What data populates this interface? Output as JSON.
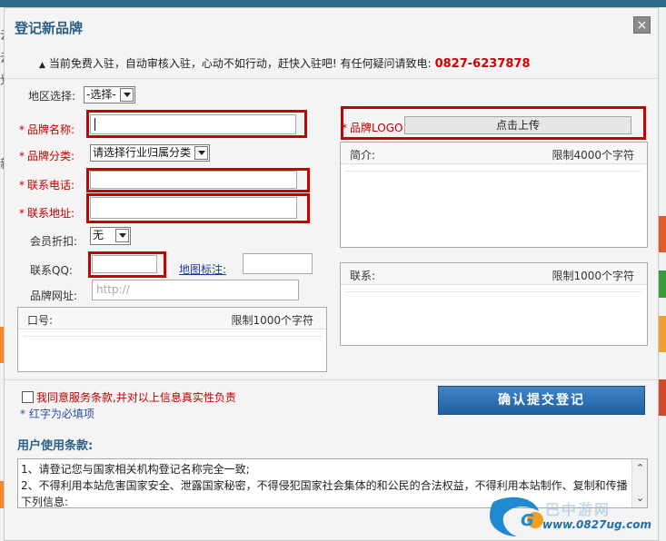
{
  "dialog": {
    "title": "登记新品牌",
    "close_label": "×",
    "notice_text": "当前免费入驻，自动审核入驻，心动不如行动，赶快入驻吧! 有任何疑问请致电:",
    "notice_phone": "0827-6237878"
  },
  "form": {
    "region_label": "地区选择:",
    "region_value": "-选择-",
    "brand_name_label": "品牌名称:",
    "brand_category_label": "品牌分类:",
    "brand_category_value": "请选择行业归属分类",
    "phone_label": "联系电话:",
    "address_label": "联系地址:",
    "discount_label": "会员折扣:",
    "discount_value": "无",
    "qq_label": "联系QQ:",
    "map_link": "地图标注:",
    "website_label": "品牌网址:",
    "website_placeholder": "http://",
    "slogan_label": "口号:",
    "slogan_limit": "限制1000个字符",
    "logo_label": "品牌LOGO",
    "upload_label": "点击上传",
    "intro_label": "简介:",
    "intro_limit": "限制4000个字符",
    "contact_label": "联系:",
    "contact_limit": "限制1000个字符",
    "required_star": "*",
    "agree_text": "我同意服务条款,并对以上信息真实性负责",
    "required_note": "* 红字为必填项",
    "submit_label": "确认提交登记"
  },
  "terms": {
    "title": "用户使用条款:",
    "line1": "1、请登记您与国家相关机构登记名称完全一致;",
    "line2": "2、不得利用本站危害国家安全、泄露国家秘密，不得侵犯国家社会集体的和公民的合法权益，不得利用本站制作、复制和传播下列信息:"
  },
  "watermark": {
    "url": "www.0827ug.com",
    "brand": "巴中游网"
  },
  "background": {
    "left_chars": [
      "云",
      "云",
      "划",
      "新"
    ]
  },
  "colors": {
    "title_blue": "#2b5f86",
    "required_red": "#c00000",
    "highlight_red": "#c40000",
    "submit_blue": "#1f5f9e"
  }
}
